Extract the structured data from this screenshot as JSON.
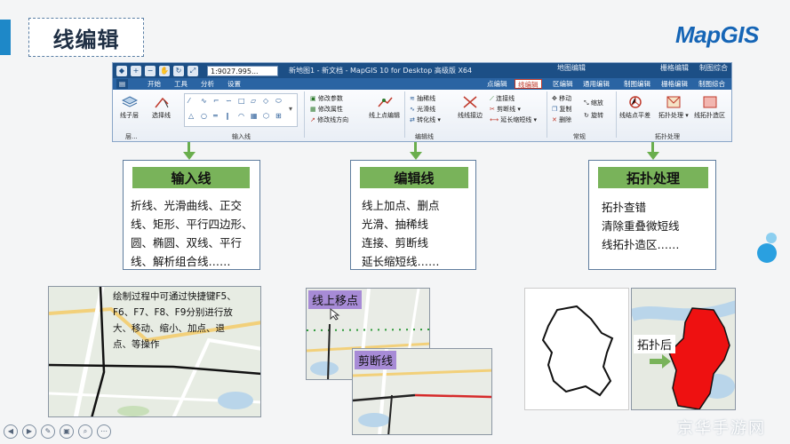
{
  "slide": {
    "title": "线编辑",
    "logo": "MapGIS"
  },
  "app": {
    "scale": "1:9027.995...",
    "title": "新地图1 - 新文档 - MapGIS 10 for Desktop 高级版 X64",
    "context_groups": [
      "地图编辑",
      "栅格编辑",
      "制图综合"
    ],
    "menu": [
      "开始",
      "工具",
      "分析",
      "设置"
    ],
    "tabs": [
      "点编辑",
      "线编辑",
      "区编辑",
      "通用编辑",
      "制图编辑",
      "栅格编辑",
      "制图综合"
    ],
    "active_tab": "线编辑",
    "ribbon": {
      "layer": "线子层",
      "select": "选择线",
      "edit_params": "修改参数",
      "edit_attrs": "修改属性",
      "edit_dir": "修改线方向",
      "add_point": "线上点编辑",
      "thin": "抽稀线",
      "smooth": "光滑线",
      "convert": "转化线",
      "snap": "线线接边",
      "join": "连接线",
      "cut": "剪断线",
      "extend": "延长缩短线",
      "move": "移动",
      "copy": "复制",
      "delete": "删除",
      "scale": "缩放",
      "rotate": "旋转",
      "node_adjust": "线结点平差",
      "topo": "拓扑处理",
      "topo_area": "线拓扑造区",
      "groups": [
        "层...",
        "输入线",
        "编辑线",
        "常规",
        "拓扑处理"
      ]
    }
  },
  "cards": [
    {
      "title": "输入线",
      "lines": [
        "折线、光滑曲线、正交",
        "线、矩形、平行四边形、",
        "圆、椭圆、双线、平行",
        "线、解析组合线……"
      ]
    },
    {
      "title": "编辑线",
      "lines": [
        "线上加点、删点",
        "光滑、抽稀线",
        "连接、剪断线",
        "延长缩短线……"
      ]
    },
    {
      "title": "拓扑处理",
      "lines": [
        "拓扑查错",
        "清除重叠微短线",
        "线拓扑造区……"
      ]
    }
  ],
  "map_notes": [
    "绘制过程中可通过快捷键F5、",
    "F6、F7、F8、F9分别进行放",
    "大、移动、缩小、加点、退",
    "点、等操作"
  ],
  "labels": {
    "move_point": "线上移点",
    "cut_line": "剪断线",
    "after_topo": "拓扑后"
  },
  "footer": {
    "controls": [
      "◀",
      "▶",
      "✎",
      "▣",
      "⌕",
      "⋯"
    ],
    "watermark": "京华手游网"
  }
}
